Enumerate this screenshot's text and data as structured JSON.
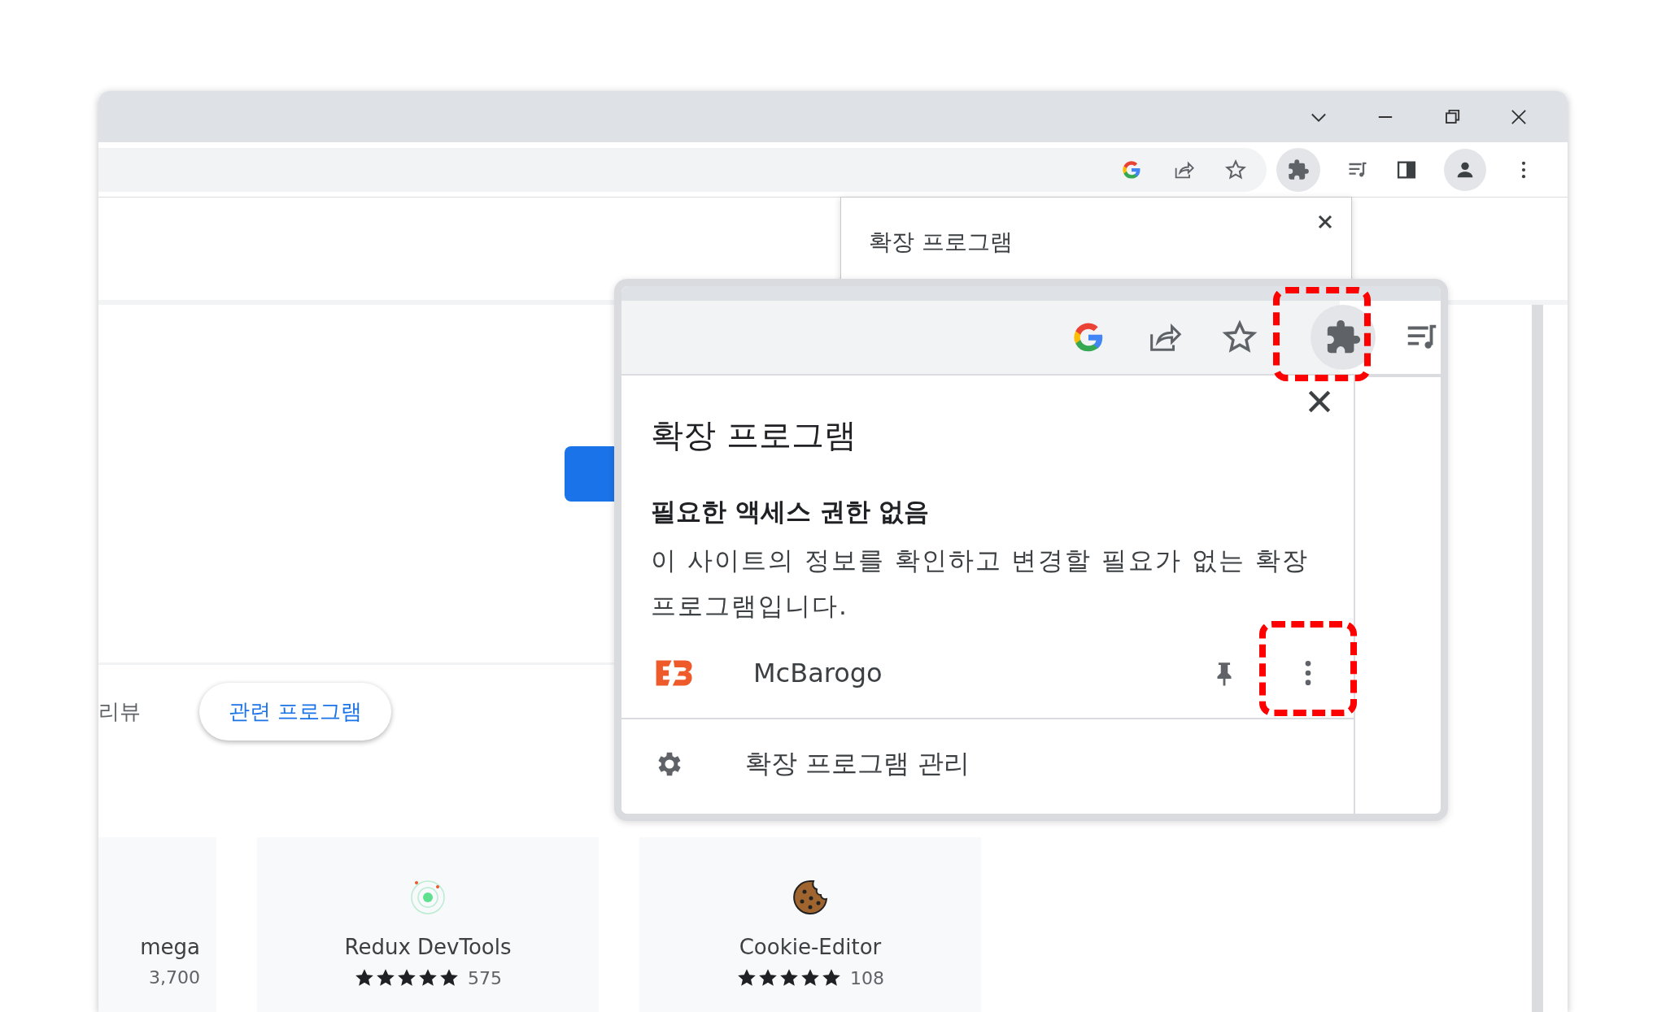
{
  "popup": {
    "title": "확장 프로그램"
  },
  "page": {
    "tabs": [
      {
        "label": "리뷰",
        "selected": false
      },
      {
        "label": "관련 프로그램",
        "selected": true
      }
    ],
    "cards": [
      {
        "kind": "partial",
        "name": "mega",
        "count": "3,700"
      },
      {
        "kind": "redux",
        "name": "Redux DevTools",
        "stars": 5,
        "count": "575"
      },
      {
        "kind": "cookie",
        "name": "Cookie-Editor",
        "stars": 5,
        "count": "108"
      }
    ]
  },
  "inset": {
    "heading": "확장 프로그램",
    "access_title": "필요한 액세스 권한 없음",
    "access_text": "이 사이트의 정보를 확인하고 변경할 필요가 없는 확장 프로그램입니다.",
    "extensions": [
      {
        "name": "McBarogo"
      }
    ],
    "manage_label": "확장 프로그램 관리"
  }
}
